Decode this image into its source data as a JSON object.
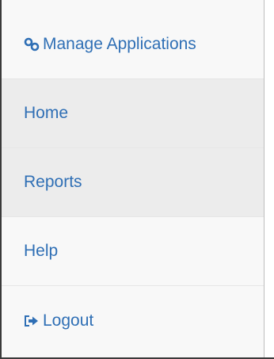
{
  "nav": {
    "items": [
      {
        "label": "Manage Applications",
        "icon": "link-icon",
        "active": false
      },
      {
        "label": "Home",
        "icon": null,
        "active": true
      },
      {
        "label": "Reports",
        "icon": null,
        "active": true
      },
      {
        "label": "Help",
        "icon": null,
        "active": false
      },
      {
        "label": "Logout",
        "icon": "logout-icon",
        "active": false
      }
    ]
  },
  "colors": {
    "link": "#2f6fb5",
    "panel_bg": "#f8f8f8",
    "active_bg": "#ececec",
    "divider": "#e6e6e6"
  }
}
